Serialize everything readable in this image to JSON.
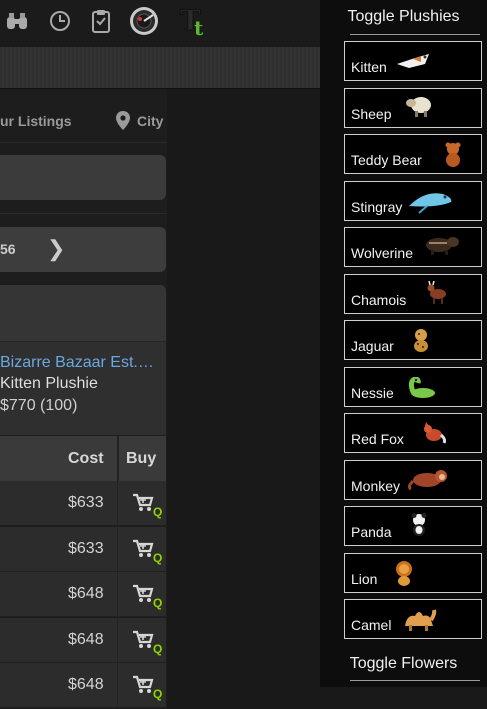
{
  "toolbar": {
    "icons": [
      "binoculars-icon",
      "clock-icon",
      "clipboard-icon",
      "radar-icon",
      "torn-logo"
    ],
    "logo_big": "T",
    "logo_small": "t"
  },
  "nav": {
    "listings_label": "ur Listings",
    "city_label": "City"
  },
  "pager": {
    "page_text": "56",
    "next_arrow": "❯"
  },
  "item": {
    "shop_name": "Bizarre Bazaar Est.2…",
    "item_name": "Kitten Plushie",
    "price_text": "$770 (100)"
  },
  "table": {
    "headers": {
      "cost": "Cost",
      "buy": "Buy"
    },
    "rows": [
      {
        "cost": "$633",
        "buy_suffix": "Q"
      },
      {
        "cost": "$633",
        "buy_suffix": "Q"
      },
      {
        "cost": "$648",
        "buy_suffix": "Q"
      },
      {
        "cost": "$648",
        "buy_suffix": "Q"
      },
      {
        "cost": "$648",
        "buy_suffix": "Q"
      }
    ]
  },
  "sidebar": {
    "title_plushies": "Toggle Plushies",
    "title_flowers": "Toggle Flowers",
    "plushies": [
      {
        "label": "Kitten",
        "icon": "kitten-plushie-icon"
      },
      {
        "label": "Sheep",
        "icon": "sheep-plushie-icon"
      },
      {
        "label": "Teddy Bear",
        "icon": "teddy-bear-plushie-icon"
      },
      {
        "label": "Stingray",
        "icon": "stingray-plushie-icon"
      },
      {
        "label": "Wolverine",
        "icon": "wolverine-plushie-icon"
      },
      {
        "label": "Chamois",
        "icon": "chamois-plushie-icon"
      },
      {
        "label": "Jaguar",
        "icon": "jaguar-plushie-icon"
      },
      {
        "label": "Nessie",
        "icon": "nessie-plushie-icon"
      },
      {
        "label": "Red Fox",
        "icon": "red-fox-plushie-icon"
      },
      {
        "label": "Monkey",
        "icon": "monkey-plushie-icon"
      },
      {
        "label": "Panda",
        "icon": "panda-plushie-icon"
      },
      {
        "label": "Lion",
        "icon": "lion-plushie-icon"
      },
      {
        "label": "Camel",
        "icon": "camel-plushie-icon"
      }
    ]
  },
  "colors": {
    "link": "#6aa8e0",
    "quick_buy": "#8fd400",
    "logo_green": "#5cb82c"
  }
}
